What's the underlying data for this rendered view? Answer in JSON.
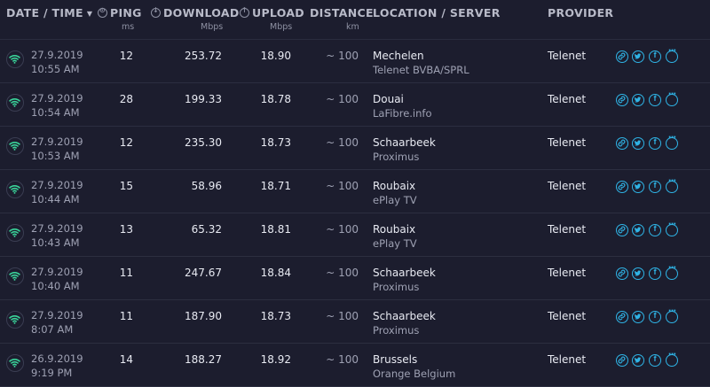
{
  "header": {
    "datetime": "DATE / TIME",
    "ping": "PING",
    "ping_unit": "ms",
    "download": "DOWNLOAD",
    "download_unit": "Mbps",
    "upload": "UPLOAD",
    "upload_unit": "Mbps",
    "distance": "DISTANCE",
    "distance_unit": "km",
    "location": "LOCATION / SERVER",
    "provider": "PROVIDER"
  },
  "icons": {
    "sort": "caret-down-icon",
    "ping": "ping-icon",
    "download": "download-arrow-icon",
    "upload": "upload-arrow-icon",
    "connection": "wifi-icon",
    "actions": [
      "link-icon",
      "twitter-icon",
      "facebook-icon",
      "more-icon"
    ]
  },
  "colors": {
    "background": "#1c1d2e",
    "accent": "#2fb4e6",
    "text": "#e8eaf2",
    "muted": "#9ea1b3"
  },
  "rows": [
    {
      "date": "27.9.2019",
      "time": "10:55 AM",
      "ping": "12",
      "download": "253.72",
      "upload": "18.90",
      "distance": "~ 100",
      "location": "Mechelen",
      "server": "Telenet BVBA/SPRL",
      "provider": "Telenet"
    },
    {
      "date": "27.9.2019",
      "time": "10:54 AM",
      "ping": "28",
      "download": "199.33",
      "upload": "18.78",
      "distance": "~ 100",
      "location": "Douai",
      "server": "LaFibre.info",
      "provider": "Telenet"
    },
    {
      "date": "27.9.2019",
      "time": "10:53 AM",
      "ping": "12",
      "download": "235.30",
      "upload": "18.73",
      "distance": "~ 100",
      "location": "Schaarbeek",
      "server": "Proximus",
      "provider": "Telenet"
    },
    {
      "date": "27.9.2019",
      "time": "10:44 AM",
      "ping": "15",
      "download": "58.96",
      "upload": "18.71",
      "distance": "~ 100",
      "location": "Roubaix",
      "server": "ePlay TV",
      "provider": "Telenet"
    },
    {
      "date": "27.9.2019",
      "time": "10:43 AM",
      "ping": "13",
      "download": "65.32",
      "upload": "18.81",
      "distance": "~ 100",
      "location": "Roubaix",
      "server": "ePlay TV",
      "provider": "Telenet"
    },
    {
      "date": "27.9.2019",
      "time": "10:40 AM",
      "ping": "11",
      "download": "247.67",
      "upload": "18.84",
      "distance": "~ 100",
      "location": "Schaarbeek",
      "server": "Proximus",
      "provider": "Telenet"
    },
    {
      "date": "27.9.2019",
      "time": "8:07 AM",
      "ping": "11",
      "download": "187.90",
      "upload": "18.73",
      "distance": "~ 100",
      "location": "Schaarbeek",
      "server": "Proximus",
      "provider": "Telenet"
    },
    {
      "date": "26.9.2019",
      "time": "9:19 PM",
      "ping": "14",
      "download": "188.27",
      "upload": "18.92",
      "distance": "~ 100",
      "location": "Brussels",
      "server": "Orange Belgium",
      "provider": "Telenet"
    }
  ]
}
